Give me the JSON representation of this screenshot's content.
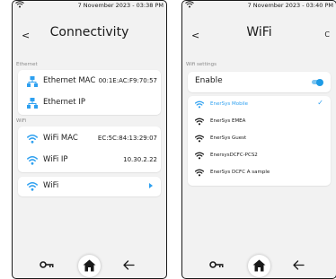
{
  "left": {
    "time": "7 November 2023 - 03:38 PM",
    "title": "Connectivity",
    "back": "<",
    "ethernet_label": "Ethernet",
    "ethernet_rows": [
      {
        "label": "Ethernet MAC",
        "value": "00:1E:AC:F9:70:57"
      },
      {
        "label": "Ethernet IP",
        "value": ""
      }
    ],
    "wifi_label": "WiFi",
    "wifi_rows": [
      {
        "label": "WiFi MAC",
        "value": "EC:5C:84:13:29:07"
      },
      {
        "label": "WiFi IP",
        "value": "10.30.2.22"
      }
    ],
    "wifi_nav_label": "WiFi"
  },
  "right": {
    "time": "7 November 2023 - 03:40 PM",
    "title": "WiFi",
    "back": "<",
    "refresh": "C",
    "settings_label": "Wifi settings",
    "enable_label": "Enable",
    "enabled": true,
    "networks": [
      {
        "name": "EnerSys Mobile",
        "connected": true
      },
      {
        "name": "EnerSys EMEA",
        "connected": false
      },
      {
        "name": "EnerSys Guest",
        "connected": false
      },
      {
        "name": "EnersysDCFC-PCS2",
        "connected": false
      },
      {
        "name": "EnerSys DCFC A sample",
        "connected": false
      }
    ],
    "check": "✓"
  },
  "colors": {
    "accent": "#2ea0f0",
    "background": "#f2f2f2",
    "card": "#ffffff"
  }
}
